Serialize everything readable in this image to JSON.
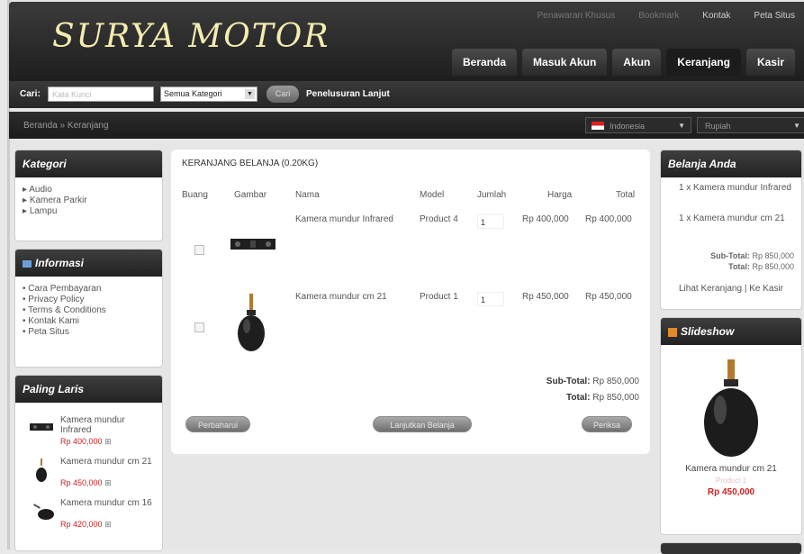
{
  "header": {
    "logo": "SURYA MOTOR",
    "top_links": [
      "Penawaran Khusus",
      "Bookmark",
      "Kontak",
      "Peta Situs"
    ],
    "tabs": [
      "Beranda",
      "Masuk Akun",
      "Akun",
      "Keranjang",
      "Kasir"
    ],
    "active_tab": "Keranjang"
  },
  "search": {
    "label": "Cari:",
    "placeholder": "Kata Kunci",
    "category": "Semua Kategori",
    "button": "Cari",
    "advanced": "Penelusuran Lanjut"
  },
  "breadcrumb": "Beranda » Keranjang",
  "language": "Indonesia",
  "currency": "Rupiah",
  "sidebar_left": {
    "kategori": {
      "title": "Kategori",
      "items": [
        "Audio",
        "Kamera Parkir",
        "Lampu"
      ]
    },
    "informasi": {
      "title": "Informasi",
      "items": [
        "Cara Pembayaran",
        "Privacy Policy",
        "Terms & Conditions",
        "Kontak Kami",
        "Peta Situs"
      ]
    },
    "paling_laris": {
      "title": "Paling Laris",
      "items": [
        {
          "name": "Kamera mundur Infrared",
          "price": "Rp 400,000"
        },
        {
          "name": "Kamera mundur cm 21",
          "price": "Rp 450,000"
        },
        {
          "name": "Kamera mundur cm 16",
          "price": "Rp 420,000"
        }
      ]
    }
  },
  "cart": {
    "title": "KERANJANG BELANJA",
    "weight": "(0.20KG)",
    "headers": {
      "remove": "Buang",
      "image": "Gambar",
      "name": "Nama",
      "model": "Model",
      "qty": "Jumlah",
      "price": "Harga",
      "total": "Total"
    },
    "rows": [
      {
        "name": "Kamera mundur Infrared",
        "model": "Product 4",
        "qty": "1",
        "price": "Rp 400,000",
        "total": "Rp 400,000"
      },
      {
        "name": "Kamera mundur cm 21",
        "model": "Product 1",
        "qty": "1",
        "price": "Rp 450,000",
        "total": "Rp 450,000"
      }
    ],
    "subtotal_label": "Sub-Total:",
    "subtotal": "Rp 850,000",
    "total_label": "Total:",
    "total": "Rp 850,000",
    "buttons": {
      "update": "Perbaharui",
      "continue": "Lanjutkan Belanja",
      "checkout": "Periksa"
    }
  },
  "sidebar_right": {
    "cart": {
      "title": "Belanja Anda",
      "items": [
        {
          "qty": "1 x",
          "name": "Kamera mundur Infrared"
        },
        {
          "qty": "1 x",
          "name": "Kamera mundur cm 21"
        }
      ],
      "subtotal_label": "Sub-Total:",
      "subtotal": "Rp 850,000",
      "total_label": "Total:",
      "total": "Rp 850,000",
      "view_cart": "Lihat Keranjang",
      "separator": "|",
      "checkout": "Ke Kasir"
    },
    "slideshow": {
      "title": "Slideshow",
      "product": "Kamera mundur cm 21",
      "model": "Product 1",
      "price": "Rp 450,000"
    }
  },
  "colors": {
    "header_dark": "#222222",
    "price_red": "#cc2222",
    "logo_cream": "#f4ecb0"
  }
}
